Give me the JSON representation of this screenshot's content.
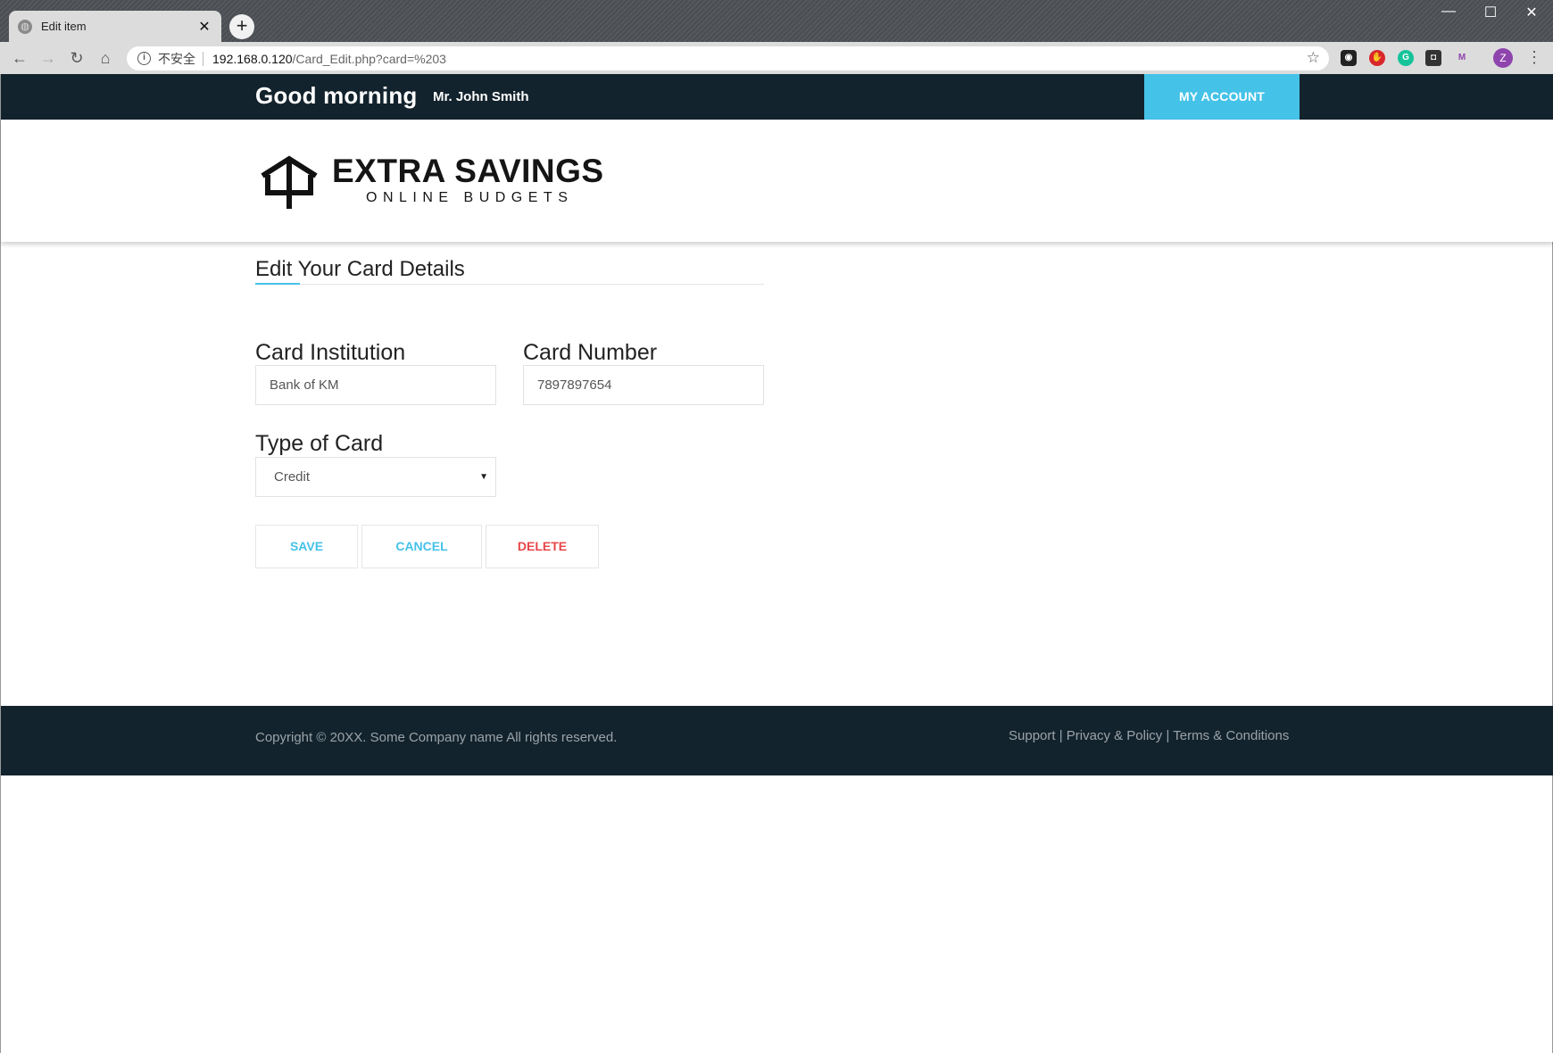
{
  "browser": {
    "tab_title": "Edit item",
    "tab_close": "✕",
    "new_tab": "+",
    "insecure_label": "不安全",
    "url_host": "192.168.0.120",
    "url_path": "/Card_Edit.php?card=%203",
    "profile_initial": "Z",
    "window_controls": {
      "minimize": "—",
      "maximize": "☐",
      "close": "✕"
    }
  },
  "header": {
    "greeting": "Good morning",
    "user_name": "Mr. John Smith",
    "account_button": "MY ACCOUNT"
  },
  "logo": {
    "main": "EXTRA SAVINGS",
    "sub": "ONLINE BUDGETS"
  },
  "form": {
    "title": "Edit Your Card Details",
    "institution": {
      "label": "Card Institution",
      "value": "Bank of KM"
    },
    "number": {
      "label": "Card Number",
      "value": "7897897654"
    },
    "type": {
      "label": "Type of Card",
      "selected": "Credit"
    },
    "buttons": {
      "save": "SAVE",
      "cancel": "CANCEL",
      "delete": "DELETE"
    }
  },
  "footer": {
    "copyright": "Copyright © 20XX. Some Company name All rights reserved.",
    "links": {
      "support": "Support",
      "privacy": "Privacy & Policy",
      "terms": "Terms & Conditions",
      "separator": " | "
    }
  },
  "colors": {
    "dark_bar": "#13232d",
    "accent": "#45c2e8",
    "danger": "#e8474a"
  }
}
